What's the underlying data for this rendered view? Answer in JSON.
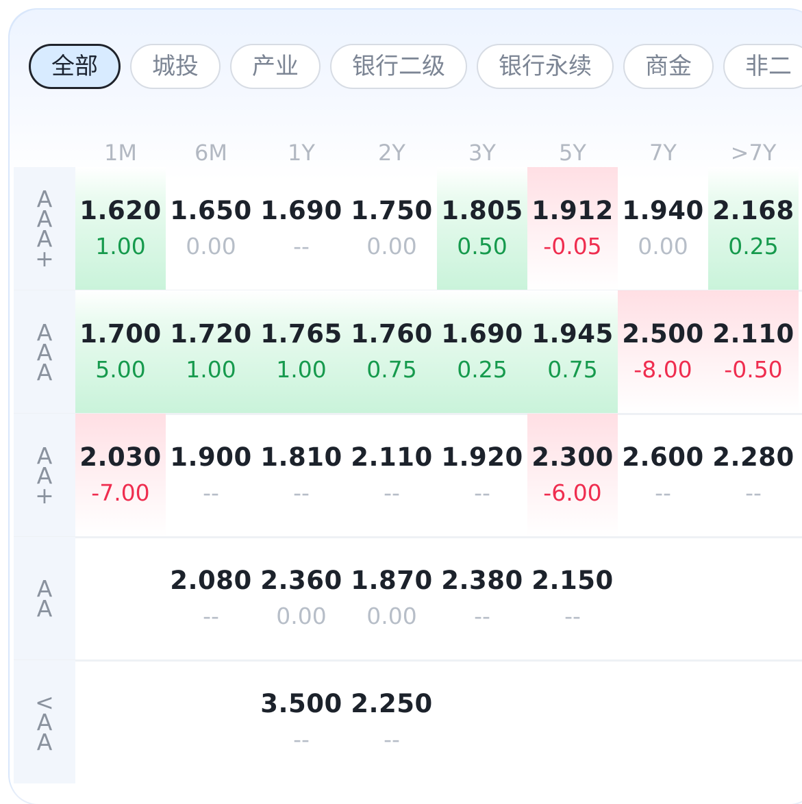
{
  "tabs": [
    {
      "label": "全部",
      "active": true
    },
    {
      "label": "城投",
      "active": false
    },
    {
      "label": "产业",
      "active": false
    },
    {
      "label": "银行二级",
      "active": false
    },
    {
      "label": "银行永续",
      "active": false
    },
    {
      "label": "商金",
      "active": false
    },
    {
      "label": "非二",
      "active": false
    }
  ],
  "columns": [
    "1M",
    "6M",
    "1Y",
    "2Y",
    "3Y",
    "5Y",
    "7Y",
    ">7Y"
  ],
  "rows": [
    {
      "label": [
        "A",
        "A",
        "A",
        "+"
      ],
      "cells": [
        {
          "rate": "1.620",
          "change": "1.00",
          "trend": "up"
        },
        {
          "rate": "1.650",
          "change": "0.00",
          "trend": "flat"
        },
        {
          "rate": "1.690",
          "change": "--",
          "trend": "flat"
        },
        {
          "rate": "1.750",
          "change": "0.00",
          "trend": "flat"
        },
        {
          "rate": "1.805",
          "change": "0.50",
          "trend": "up"
        },
        {
          "rate": "1.912",
          "change": "-0.05",
          "trend": "down"
        },
        {
          "rate": "1.940",
          "change": "0.00",
          "trend": "flat"
        },
        {
          "rate": "2.168",
          "change": "0.25",
          "trend": "up"
        }
      ]
    },
    {
      "label": [
        "A",
        "A",
        "A"
      ],
      "cells": [
        {
          "rate": "1.700",
          "change": "5.00",
          "trend": "up"
        },
        {
          "rate": "1.720",
          "change": "1.00",
          "trend": "up"
        },
        {
          "rate": "1.765",
          "change": "1.00",
          "trend": "up"
        },
        {
          "rate": "1.760",
          "change": "0.75",
          "trend": "up"
        },
        {
          "rate": "1.690",
          "change": "0.25",
          "trend": "up"
        },
        {
          "rate": "1.945",
          "change": "0.75",
          "trend": "up"
        },
        {
          "rate": "2.500",
          "change": "-8.00",
          "trend": "down"
        },
        {
          "rate": "2.110",
          "change": "-0.50",
          "trend": "down"
        }
      ]
    },
    {
      "label": [
        "A",
        "A",
        "+"
      ],
      "cells": [
        {
          "rate": "2.030",
          "change": "-7.00",
          "trend": "down"
        },
        {
          "rate": "1.900",
          "change": "--",
          "trend": "flat"
        },
        {
          "rate": "1.810",
          "change": "--",
          "trend": "flat"
        },
        {
          "rate": "2.110",
          "change": "--",
          "trend": "flat"
        },
        {
          "rate": "1.920",
          "change": "--",
          "trend": "flat"
        },
        {
          "rate": "2.300",
          "change": "-6.00",
          "trend": "down"
        },
        {
          "rate": "2.600",
          "change": "--",
          "trend": "flat"
        },
        {
          "rate": "2.280",
          "change": "--",
          "trend": "flat"
        }
      ]
    },
    {
      "label": [
        "A",
        "A"
      ],
      "cells": [
        null,
        {
          "rate": "2.080",
          "change": "--",
          "trend": "flat"
        },
        {
          "rate": "2.360",
          "change": "0.00",
          "trend": "flat"
        },
        {
          "rate": "1.870",
          "change": "0.00",
          "trend": "flat"
        },
        {
          "rate": "2.380",
          "change": "--",
          "trend": "flat"
        },
        {
          "rate": "2.150",
          "change": "--",
          "trend": "flat"
        },
        null,
        null
      ]
    },
    {
      "label": [
        "<",
        "A",
        "A"
      ],
      "cells": [
        null,
        null,
        {
          "rate": "3.500",
          "change": "--",
          "trend": "flat"
        },
        {
          "rate": "2.250",
          "change": "--",
          "trend": "flat"
        },
        null,
        null,
        null,
        null
      ]
    }
  ]
}
